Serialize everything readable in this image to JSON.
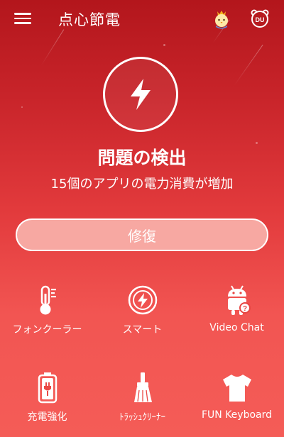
{
  "header": {
    "app_title": "点心節電",
    "icons": {
      "menu": "menu-icon",
      "chick": "chick-avatar-icon",
      "du": "du-bear-icon"
    }
  },
  "status": {
    "icon": "lightning-bolt-icon",
    "title": "問題の検出",
    "subtitle": "15個のアプリの電力消費が増加"
  },
  "repair": {
    "label": "修復"
  },
  "grid": [
    {
      "label": "フォンクーラー",
      "icon": "thermometer-icon"
    },
    {
      "label": "スマート",
      "icon": "smart-bolt-icon"
    },
    {
      "label": "Video Chat",
      "icon": "android-robot-icon"
    },
    {
      "label": "充電強化",
      "icon": "battery-charge-icon"
    },
    {
      "label": "ﾄﾗｯｼｭｸﾘｰﾅｰ",
      "icon": "broom-icon"
    },
    {
      "label": "FUN Keyboard",
      "icon": "tshirt-icon"
    }
  ],
  "colors": {
    "background_top": "#b3161c",
    "background_bottom": "#f45c57",
    "button_fill": "#f7a8a2"
  }
}
